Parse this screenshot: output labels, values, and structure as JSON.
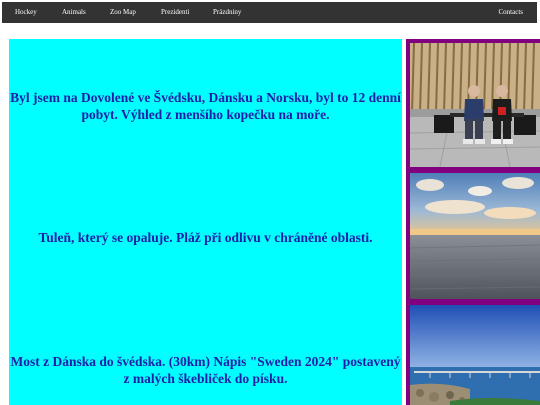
{
  "nav": {
    "items": [
      {
        "label": "Hockey"
      },
      {
        "label": "Animals"
      },
      {
        "label": "Zoo Map"
      },
      {
        "label": "Prezidenti"
      },
      {
        "label": "Prázdniny"
      }
    ],
    "contacts_label": "Contacts"
  },
  "main": {
    "paragraphs": [
      {
        "text": "Byl jsem na Dovolené ve Švédsku, Dánsku a Norsku, byl to 12 denní pobyt. Výhled z menšího kopečku na moře."
      },
      {
        "text": "Tuleň, který se opaluje. Pláž při odlivu v chráněné oblasti."
      },
      {
        "text": "Most z Dánska do švédska. (30km) Nápis \"Sweden 2024\" postavený z malých škebliček do písku."
      }
    ]
  },
  "colors": {
    "navbar_bg": "#333333",
    "text_panel_bg": "#00ffff",
    "text_color": "#1e1ea8",
    "photo_border": "#800080"
  }
}
